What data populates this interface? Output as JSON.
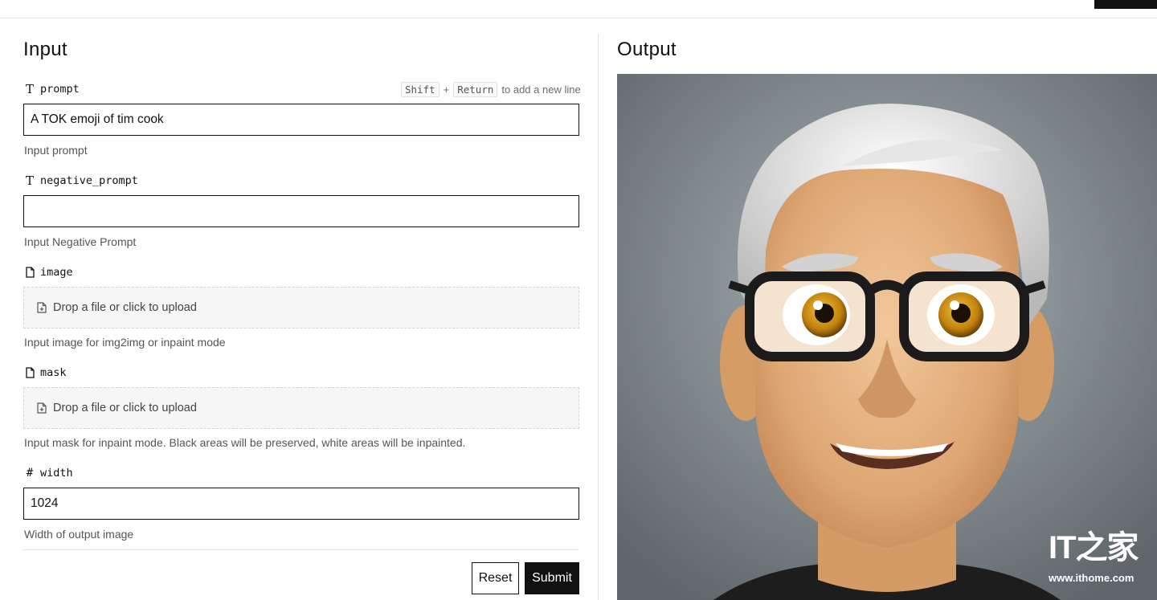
{
  "input_panel": {
    "title": "Input",
    "shortcut": {
      "key1": "Shift",
      "plus": "+",
      "key2": "Return",
      "suffix": "to add a new line"
    },
    "fields": {
      "prompt": {
        "name": "prompt",
        "icon": "text-type-icon",
        "value": "A TOK emoji of tim cook",
        "help": "Input prompt"
      },
      "negative_prompt": {
        "name": "negative_prompt",
        "icon": "text-type-icon",
        "value": "",
        "help": "Input Negative Prompt"
      },
      "image": {
        "name": "image",
        "icon": "file-icon",
        "dropzone": "Drop a file or click to upload",
        "help": "Input image for img2img or inpaint mode"
      },
      "mask": {
        "name": "mask",
        "icon": "file-icon",
        "dropzone": "Drop a file or click to upload",
        "help": "Input mask for inpaint mode. Black areas will be preserved, white areas will be inpainted."
      },
      "width": {
        "name": "width",
        "icon": "hash-icon",
        "value": "1024",
        "help": "Width of output image"
      }
    },
    "buttons": {
      "reset": "Reset",
      "submit": "Submit"
    }
  },
  "output_panel": {
    "title": "Output",
    "image": "emoji-portrait-of-man-with-glasses",
    "watermark": {
      "logo": "IT之家",
      "url": "www.ithome.com"
    }
  },
  "colors": {
    "accent": "#111111",
    "dropzone_bg": "#f6f6f6",
    "help_text": "#555555",
    "output_bg": "#6a7276"
  }
}
